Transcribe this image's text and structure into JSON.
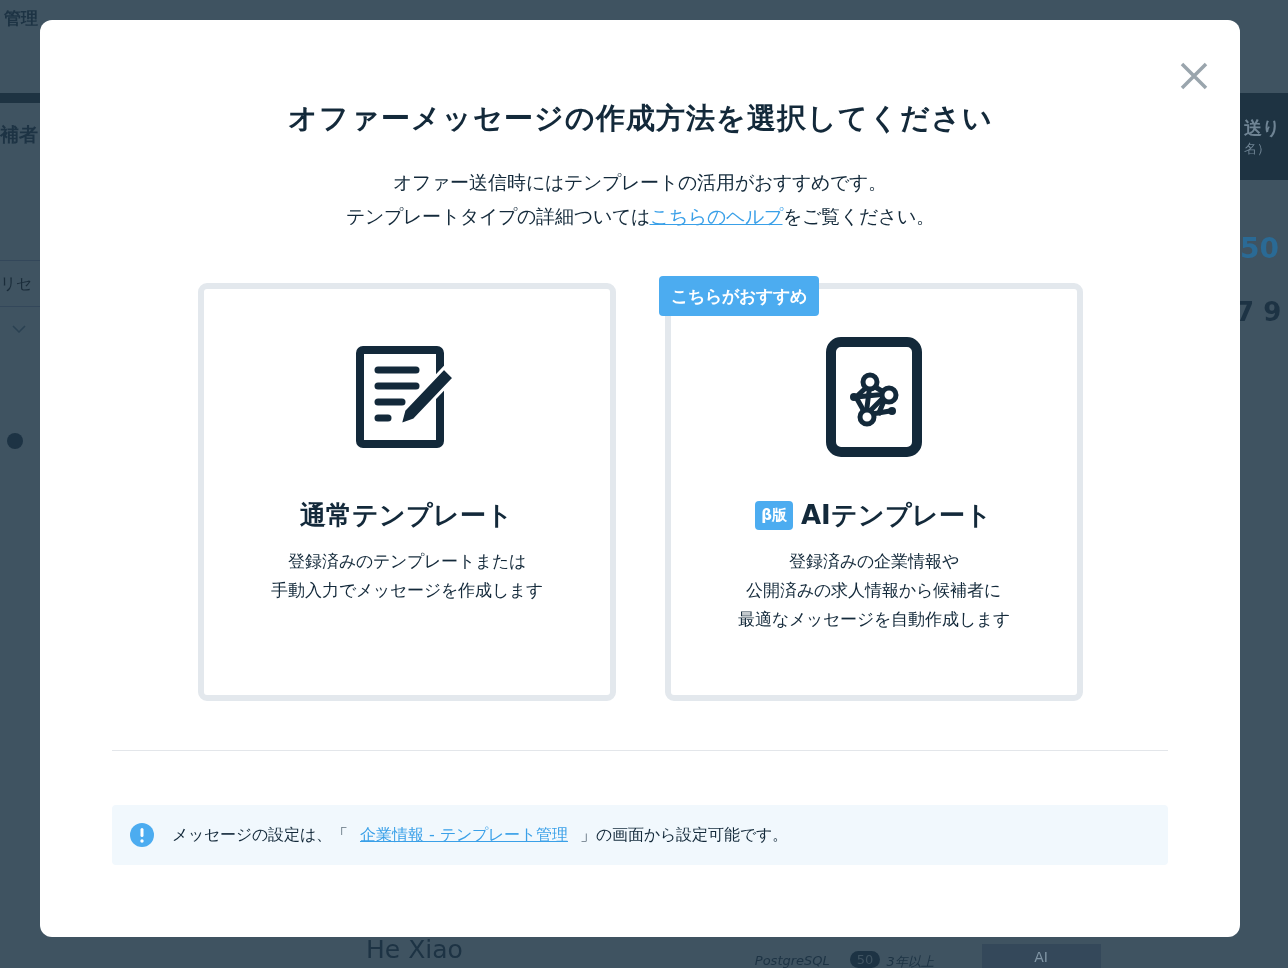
{
  "background": {
    "header_title": "管理",
    "left_heading": "補者",
    "left_filter": "リセ",
    "right_panel": {
      "title": "送り",
      "subtitle": "名）"
    },
    "right_count": "50",
    "right_number": "7 9",
    "candidate": {
      "name": "He Xiao",
      "skill": "PostgreSQL",
      "level": "50",
      "years": "3年以上",
      "action": "AI"
    }
  },
  "modal": {
    "title": "オファーメッセージの作成方法を選択してください",
    "intro": "オファー送信時にはテンプレートの活用がおすすめです。",
    "help": {
      "before": "テンプレートタイプの詳細ついては",
      "link": "こちらのヘルプ",
      "after": "をご覧ください。"
    },
    "options": [
      {
        "kind": "standard",
        "title": "通常テンプレート",
        "description": [
          "登録済みのテンプレートまたは",
          "手動入力でメッセージを作成します"
        ]
      },
      {
        "kind": "ai",
        "badge": "こちらがおすすめ",
        "tag": "β版",
        "title": "AIテンプレート",
        "description": [
          "登録済みの企業情報や",
          "公開済みの求人情報から候補者に",
          "最適なメッセージを自動作成します"
        ]
      }
    ],
    "notice": {
      "before": "メッセージの設定は、「",
      "link": "企業情報 - テンプレート管理",
      "after": "」の画面から設定可能です。"
    }
  }
}
